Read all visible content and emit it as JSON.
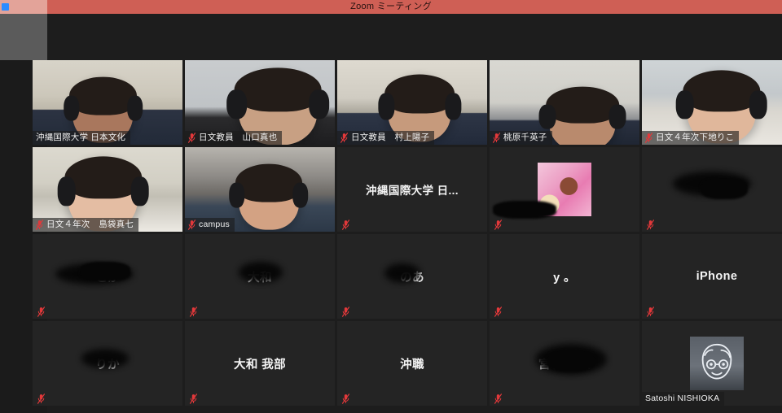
{
  "window": {
    "title": "Zoom ミーティング",
    "app_icon": "zoom-app-icon",
    "titlebar_color": "#cf5f55",
    "stage_color": "#1d1d1d",
    "tile_color": "#242424",
    "active_speaker_color": "#cde04a",
    "mute_icon_color": "#e2383a"
  },
  "gallery": {
    "columns": 5,
    "rows": 4,
    "participants": [
      {
        "id": "p1",
        "name": "沖縄国際大学 日本文化",
        "video": true,
        "muted": false,
        "active_speaker": true,
        "name_position": "bottom-left",
        "redacted": false,
        "avatar": null
      },
      {
        "id": "p2",
        "name": "日文教員　山口真也",
        "video": true,
        "muted": true,
        "active_speaker": false,
        "name_position": "bottom-left",
        "redacted": false,
        "avatar": null
      },
      {
        "id": "p3",
        "name": "日文教員　村上陽子",
        "video": true,
        "muted": true,
        "active_speaker": false,
        "name_position": "bottom-left",
        "redacted": false,
        "avatar": null
      },
      {
        "id": "p4",
        "name": "桃原千英子",
        "video": true,
        "muted": true,
        "active_speaker": false,
        "name_position": "bottom-left",
        "redacted": false,
        "avatar": null
      },
      {
        "id": "p5",
        "name": "日文４年次下地りこ",
        "video": true,
        "muted": true,
        "active_speaker": false,
        "name_position": "bottom-left",
        "redacted": false,
        "avatar": null
      },
      {
        "id": "p6",
        "name": "日文４年次　島袋真七",
        "video": true,
        "muted": true,
        "active_speaker": false,
        "name_position": "bottom-left",
        "redacted": false,
        "avatar": null
      },
      {
        "id": "p7",
        "name": "campus",
        "video": true,
        "muted": true,
        "active_speaker": false,
        "name_position": "bottom-left",
        "redacted": false,
        "avatar": null
      },
      {
        "id": "p8",
        "name": "沖縄国際大学 日...",
        "video": false,
        "muted": true,
        "active_speaker": false,
        "name_position": "center",
        "redacted": false,
        "avatar": null
      },
      {
        "id": "p9",
        "name": "",
        "video": false,
        "muted": true,
        "active_speaker": false,
        "name_position": "bottom-left",
        "redacted": true,
        "avatar": "pink-food-photo"
      },
      {
        "id": "p10",
        "name": "",
        "video": false,
        "muted": true,
        "active_speaker": false,
        "name_position": "center",
        "redacted": true,
        "avatar": null
      },
      {
        "id": "p11",
        "name": "",
        "video": false,
        "muted": true,
        "active_speaker": false,
        "name_position": "center",
        "redacted": true,
        "avatar": null
      },
      {
        "id": "p12",
        "name": "",
        "video": false,
        "muted": true,
        "active_speaker": false,
        "name_position": "center",
        "redacted": true,
        "avatar": null
      },
      {
        "id": "p13",
        "name": "",
        "video": false,
        "muted": true,
        "active_speaker": false,
        "name_position": "center",
        "redacted": true,
        "avatar": null
      },
      {
        "id": "p14",
        "name": "y 。",
        "video": false,
        "muted": true,
        "active_speaker": false,
        "name_position": "center",
        "redacted": false,
        "avatar": null
      },
      {
        "id": "p15",
        "name": "iPhone",
        "video": false,
        "muted": true,
        "active_speaker": false,
        "name_position": "center",
        "redacted": false,
        "avatar": null
      },
      {
        "id": "p16",
        "name": "",
        "video": false,
        "muted": true,
        "active_speaker": false,
        "name_position": "center",
        "redacted": true,
        "avatar": null
      },
      {
        "id": "p17",
        "name": "大和 我部",
        "video": false,
        "muted": true,
        "active_speaker": false,
        "name_position": "center",
        "redacted": false,
        "avatar": null
      },
      {
        "id": "p18",
        "name": "沖職",
        "video": false,
        "muted": true,
        "active_speaker": false,
        "name_position": "center",
        "redacted": false,
        "avatar": null
      },
      {
        "id": "p19",
        "name": "",
        "video": false,
        "muted": true,
        "active_speaker": false,
        "name_position": "center",
        "redacted": true,
        "avatar": null
      },
      {
        "id": "p20",
        "name": "Satoshi NISHIOKA",
        "video": false,
        "muted": false,
        "active_speaker": false,
        "name_position": "bottom-left",
        "redacted": false,
        "avatar": "face-line-drawing"
      }
    ]
  }
}
